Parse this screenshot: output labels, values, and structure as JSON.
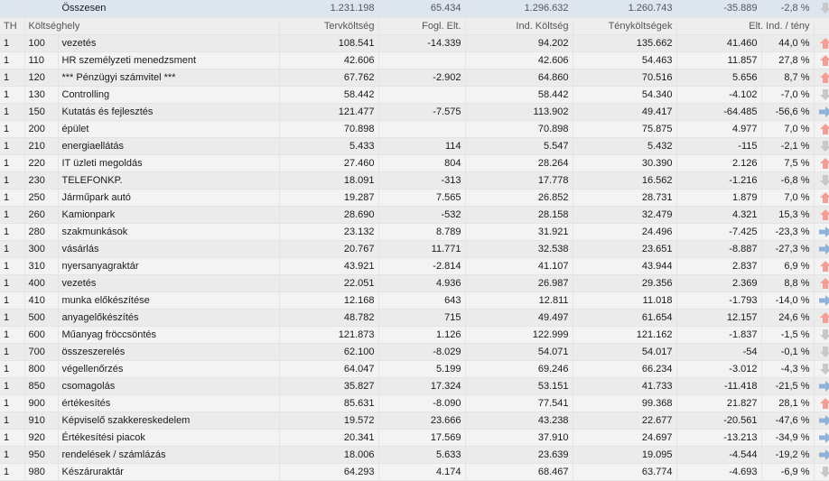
{
  "colors": {
    "up": "#f29e96",
    "down": "#c8c8c8",
    "right": "#8fb2d8"
  },
  "summary": {
    "label": "Összesen",
    "terv": "1.231.198",
    "fogl": "65.434",
    "ind": "1.296.632",
    "teny": "1.260.743",
    "elt": "-35.889",
    "pct": "-2,8 %",
    "icon": "arrow-down"
  },
  "headers": {
    "th": "TH",
    "kh": "Költséghely",
    "terv": "Tervköltség",
    "fogl": "Fogl. Elt.",
    "ind": "Ind. Költség",
    "teny": "Tényköltségek",
    "elt": "Elt. Ind. / tény"
  },
  "rows": [
    {
      "th": "1",
      "code": "100",
      "name": "vezetés",
      "terv": "108.541",
      "fogl": "-14.339",
      "ind": "94.202",
      "teny": "135.662",
      "elt": "41.460",
      "pct": "44,0 %",
      "icon": "arrow-up"
    },
    {
      "th": "1",
      "code": "110",
      "name": "HR személyzeti menedzsment",
      "terv": "42.606",
      "fogl": "",
      "ind": "42.606",
      "teny": "54.463",
      "elt": "11.857",
      "pct": "27,8 %",
      "icon": "arrow-up"
    },
    {
      "th": "1",
      "code": "120",
      "name": "*** Pénzügyi számvitel ***",
      "terv": "67.762",
      "fogl": "-2.902",
      "ind": "64.860",
      "teny": "70.516",
      "elt": "5.656",
      "pct": "8,7 %",
      "icon": "arrow-up"
    },
    {
      "th": "1",
      "code": "130",
      "name": "Controlling",
      "terv": "58.442",
      "fogl": "",
      "ind": "58.442",
      "teny": "54.340",
      "elt": "-4.102",
      "pct": "-7,0 %",
      "icon": "arrow-down"
    },
    {
      "th": "1",
      "code": "150",
      "name": "Kutatás és fejlesztés",
      "terv": "121.477",
      "fogl": "-7.575",
      "ind": "113.902",
      "teny": "49.417",
      "elt": "-64.485",
      "pct": "-56,6 %",
      "icon": "arrow-right"
    },
    {
      "th": "1",
      "code": "200",
      "name": "épület",
      "terv": "70.898",
      "fogl": "",
      "ind": "70.898",
      "teny": "75.875",
      "elt": "4.977",
      "pct": "7,0 %",
      "icon": "arrow-up"
    },
    {
      "th": "1",
      "code": "210",
      "name": "energiaellátás",
      "terv": "5.433",
      "fogl": "114",
      "ind": "5.547",
      "teny": "5.432",
      "elt": "-115",
      "pct": "-2,1 %",
      "icon": "arrow-down"
    },
    {
      "th": "1",
      "code": "220",
      "name": "IT üzleti megoldás",
      "terv": "27.460",
      "fogl": "804",
      "ind": "28.264",
      "teny": "30.390",
      "elt": "2.126",
      "pct": "7,5 %",
      "icon": "arrow-up"
    },
    {
      "th": "1",
      "code": "230",
      "name": "TELEFONKP.",
      "terv": "18.091",
      "fogl": "-313",
      "ind": "17.778",
      "teny": "16.562",
      "elt": "-1.216",
      "pct": "-6,8 %",
      "icon": "arrow-down"
    },
    {
      "th": "1",
      "code": "250",
      "name": "Járműpark autó",
      "terv": "19.287",
      "fogl": "7.565",
      "ind": "26.852",
      "teny": "28.731",
      "elt": "1.879",
      "pct": "7,0 %",
      "icon": "arrow-up"
    },
    {
      "th": "1",
      "code": "260",
      "name": "Kamionpark",
      "terv": "28.690",
      "fogl": "-532",
      "ind": "28.158",
      "teny": "32.479",
      "elt": "4.321",
      "pct": "15,3 %",
      "icon": "arrow-up"
    },
    {
      "th": "1",
      "code": "280",
      "name": "szakmunkások",
      "terv": "23.132",
      "fogl": "8.789",
      "ind": "31.921",
      "teny": "24.496",
      "elt": "-7.425",
      "pct": "-23,3 %",
      "icon": "arrow-right"
    },
    {
      "th": "1",
      "code": "300",
      "name": "vásárlás",
      "terv": "20.767",
      "fogl": "11.771",
      "ind": "32.538",
      "teny": "23.651",
      "elt": "-8.887",
      "pct": "-27,3 %",
      "icon": "arrow-right"
    },
    {
      "th": "1",
      "code": "310",
      "name": "nyersanyagraktár",
      "terv": "43.921",
      "fogl": "-2.814",
      "ind": "41.107",
      "teny": "43.944",
      "elt": "2.837",
      "pct": "6,9 %",
      "icon": "arrow-up"
    },
    {
      "th": "1",
      "code": "400",
      "name": "vezetés",
      "terv": "22.051",
      "fogl": "4.936",
      "ind": "26.987",
      "teny": "29.356",
      "elt": "2.369",
      "pct": "8,8 %",
      "icon": "arrow-up"
    },
    {
      "th": "1",
      "code": "410",
      "name": "munka előkészítése",
      "terv": "12.168",
      "fogl": "643",
      "ind": "12.811",
      "teny": "11.018",
      "elt": "-1.793",
      "pct": "-14,0 %",
      "icon": "arrow-right"
    },
    {
      "th": "1",
      "code": "500",
      "name": "anyagelőkészítés",
      "terv": "48.782",
      "fogl": "715",
      "ind": "49.497",
      "teny": "61.654",
      "elt": "12.157",
      "pct": "24,6 %",
      "icon": "arrow-up"
    },
    {
      "th": "1",
      "code": "600",
      "name": "Műanyag fröccsöntés",
      "terv": "121.873",
      "fogl": "1.126",
      "ind": "122.999",
      "teny": "121.162",
      "elt": "-1.837",
      "pct": "-1,5 %",
      "icon": "arrow-down"
    },
    {
      "th": "1",
      "code": "700",
      "name": "összeszerelés",
      "terv": "62.100",
      "fogl": "-8.029",
      "ind": "54.071",
      "teny": "54.017",
      "elt": "-54",
      "pct": "-0,1 %",
      "icon": "arrow-down"
    },
    {
      "th": "1",
      "code": "800",
      "name": "végellenőrzés",
      "terv": "64.047",
      "fogl": "5.199",
      "ind": "69.246",
      "teny": "66.234",
      "elt": "-3.012",
      "pct": "-4,3 %",
      "icon": "arrow-down"
    },
    {
      "th": "1",
      "code": "850",
      "name": "csomagolás",
      "terv": "35.827",
      "fogl": "17.324",
      "ind": "53.151",
      "teny": "41.733",
      "elt": "-11.418",
      "pct": "-21,5 %",
      "icon": "arrow-right"
    },
    {
      "th": "1",
      "code": "900",
      "name": "értékesítés",
      "terv": "85.631",
      "fogl": "-8.090",
      "ind": "77.541",
      "teny": "99.368",
      "elt": "21.827",
      "pct": "28,1 %",
      "icon": "arrow-up"
    },
    {
      "th": "1",
      "code": "910",
      "name": "Képviselő szakkereskedelem",
      "terv": "19.572",
      "fogl": "23.666",
      "ind": "43.238",
      "teny": "22.677",
      "elt": "-20.561",
      "pct": "-47,6 %",
      "icon": "arrow-right"
    },
    {
      "th": "1",
      "code": "920",
      "name": "Értékesítési piacok",
      "terv": "20.341",
      "fogl": "17.569",
      "ind": "37.910",
      "teny": "24.697",
      "elt": "-13.213",
      "pct": "-34,9 %",
      "icon": "arrow-right"
    },
    {
      "th": "1",
      "code": "950",
      "name": "rendelések / számlázás",
      "terv": "18.006",
      "fogl": "5.633",
      "ind": "23.639",
      "teny": "19.095",
      "elt": "-4.544",
      "pct": "-19,2 %",
      "icon": "arrow-right"
    },
    {
      "th": "1",
      "code": "980",
      "name": "Készáruraktár",
      "terv": "64.293",
      "fogl": "4.174",
      "ind": "68.467",
      "teny": "63.774",
      "elt": "-4.693",
      "pct": "-6,9 %",
      "icon": "arrow-down"
    }
  ]
}
